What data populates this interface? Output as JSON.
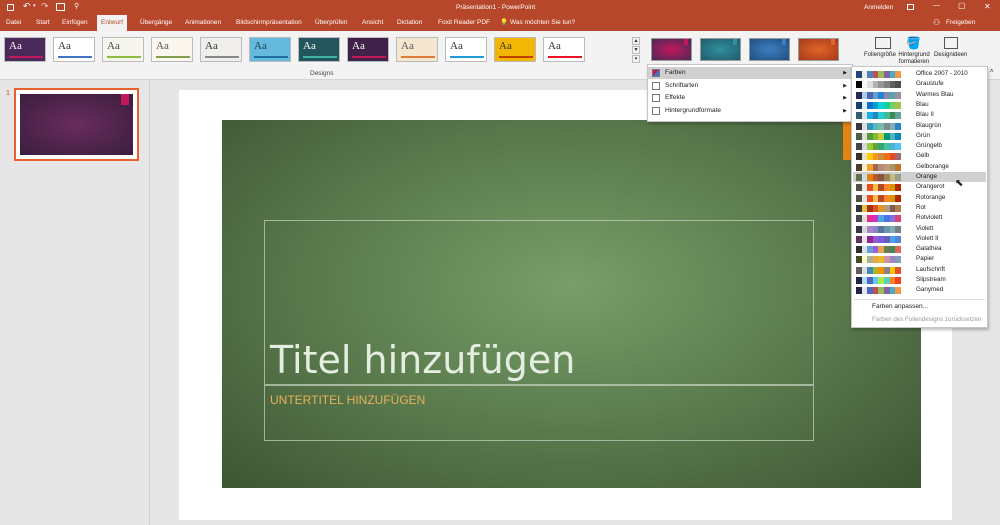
{
  "window": {
    "title": "Präsentation1 - PowerPoint",
    "user": "Anmelden",
    "share": "Freigeben",
    "quick_access": [
      "save-icon",
      "undo-icon",
      "redo-icon",
      "present-icon",
      "customize-icon"
    ],
    "window_controls": [
      "—",
      "▢",
      "✕"
    ]
  },
  "tabs": [
    "Datei",
    "Start",
    "Einfügen",
    "Entwurf",
    "Übergänge",
    "Animationen",
    "Bildschirmpräsentation",
    "Überprüfen",
    "Ansicht",
    "Dictation",
    "Foxit Reader PDF"
  ],
  "active_tab": "Entwurf",
  "tell_me": "Was möchten Sie tun?",
  "designs": {
    "group_label": "Designs",
    "theme_label": "Aa",
    "themes": [
      {
        "bg": "#4a2a5a",
        "accent": "#c2185b",
        "text": "#ffffff"
      },
      {
        "bg": "#ffffff",
        "accent": "#4472c4",
        "text": "#333333"
      },
      {
        "bg": "#f6f6ee",
        "accent": "#8cbf3f",
        "text": "#444444"
      },
      {
        "bg": "#fbf7ee",
        "accent": "#7f9f4f",
        "text": "#555555"
      },
      {
        "bg": "#f0eeea",
        "accent": "#888888",
        "text": "#333333"
      },
      {
        "bg": "#64b9dc",
        "accent": "#1e6f9f",
        "text": "#1f3b57"
      },
      {
        "bg": "#23565c",
        "accent": "#3cb4a0",
        "text": "#ffffff"
      },
      {
        "bg": "#3f2149",
        "accent": "#c2185b",
        "text": "#ffffff"
      },
      {
        "bg": "#f5e7cf",
        "accent": "#e07b39",
        "text": "#555555"
      },
      {
        "bg": "#ffffff",
        "accent": "#1f9ad6",
        "text": "#333333"
      },
      {
        "bg": "#f2b705",
        "accent": "#c04000",
        "text": "#333333"
      },
      {
        "bg": "#ffffff",
        "accent": "#e81123",
        "text": "#333333"
      }
    ],
    "variants": [
      {
        "bg": "#4a2a5a",
        "accent": "#c2185b"
      },
      {
        "bg": "#1f5c6b",
        "accent": "#2f8f9f"
      },
      {
        "bg": "#1f4f80",
        "accent": "#3d7fc0"
      },
      {
        "bg": "#a63a1a",
        "accent": "#e0652a"
      }
    ]
  },
  "customize": {
    "slide_size": "Foliengröße",
    "format_background": "Hintergrund formatieren",
    "designer": "Designideen"
  },
  "variants_menu": [
    {
      "label": "Farben",
      "underline": "F"
    },
    {
      "label": "Schriftarten",
      "underline": "S"
    },
    {
      "label": "Effekte",
      "underline": "E"
    },
    {
      "label": "Hintergrundformate",
      "underline": "H"
    }
  ],
  "color_schemes": [
    {
      "name": "Office 2007 - 2010",
      "colors": [
        "#1f497d",
        "#eeece1",
        "#4f81bd",
        "#c0504d",
        "#9bbb59",
        "#8064a2",
        "#4bacc6",
        "#f79646"
      ]
    },
    {
      "name": "Graustufe",
      "colors": [
        "#000000",
        "#f8f8f8",
        "#dddddd",
        "#b2b2b2",
        "#969696",
        "#808080",
        "#5f5f5f",
        "#4d4d4d"
      ]
    },
    {
      "name": "Warmes Blau",
      "colors": [
        "#242852",
        "#acccea",
        "#4a66ac",
        "#629dd1",
        "#297fd5",
        "#7f8fa9",
        "#5aa2ae",
        "#9d90a0"
      ]
    },
    {
      "name": "Blau",
      "colors": [
        "#17406d",
        "#dbeff9",
        "#0f6fc6",
        "#009dd9",
        "#0bd0d9",
        "#10cf9b",
        "#7cca62",
        "#a5c249"
      ]
    },
    {
      "name": "Blau II",
      "colors": [
        "#335b74",
        "#dfe3e5",
        "#1cade4",
        "#2683c6",
        "#27ced7",
        "#42ba97",
        "#3e8853",
        "#62a39f"
      ]
    },
    {
      "name": "Blaugrün",
      "colors": [
        "#373545",
        "#dedede",
        "#3494ba",
        "#58b6c0",
        "#75bda7",
        "#7a8c8e",
        "#84acb6",
        "#2683c6"
      ]
    },
    {
      "name": "Grün",
      "colors": [
        "#455f51",
        "#e3ded1",
        "#549e39",
        "#8ab833",
        "#c0cf3a",
        "#029676",
        "#4ab5c4",
        "#0989b1"
      ]
    },
    {
      "name": "Grüngelb",
      "colors": [
        "#454551",
        "#d8d9dc",
        "#99cb38",
        "#63a537",
        "#37a76f",
        "#44c1a3",
        "#4eb3cf",
        "#51c3f9"
      ]
    },
    {
      "name": "Gelb",
      "colors": [
        "#39302a",
        "#e5dec9",
        "#ffca08",
        "#f8931d",
        "#ce8d3e",
        "#ec7016",
        "#e64823",
        "#9c6a6a"
      ]
    },
    {
      "name": "Gelborange",
      "colors": [
        "#4e3b30",
        "#fbeec9",
        "#f0a22e",
        "#a5644e",
        "#b58b80",
        "#c3986d",
        "#a19574",
        "#c17529"
      ]
    },
    {
      "name": "Orange",
      "colors": [
        "#637052",
        "#ccddea",
        "#e48312",
        "#bd582c",
        "#865640",
        "#9b8357",
        "#c2bc80",
        "#94a088"
      ]
    },
    {
      "name": "Orangerot",
      "colors": [
        "#505046",
        "#eeece1",
        "#e84c22",
        "#ffbd47",
        "#b64926",
        "#ff8427",
        "#cc9900",
        "#b22600"
      ]
    },
    {
      "name": "Rotorange",
      "colors": [
        "#505046",
        "#e9e5dc",
        "#e84c22",
        "#ffbd47",
        "#b64926",
        "#ff8427",
        "#cc9900",
        "#b22600"
      ]
    },
    {
      "name": "Rot",
      "colors": [
        "#323232",
        "#e5c243",
        "#a5300f",
        "#d55816",
        "#e19825",
        "#b19c7d",
        "#7f5f52",
        "#b27d49"
      ]
    },
    {
      "name": "Rotviolett",
      "colors": [
        "#454551",
        "#e3ded1",
        "#e32d91",
        "#c830cc",
        "#4ea6dc",
        "#4775e7",
        "#8971e1",
        "#d54773"
      ]
    },
    {
      "name": "Violett",
      "colors": [
        "#373545",
        "#dcd8dc",
        "#ad84c6",
        "#8784c7",
        "#5d739a",
        "#6997af",
        "#84acb6",
        "#6f8183"
      ]
    },
    {
      "name": "Violett II",
      "colors": [
        "#632e62",
        "#eae5eb",
        "#92278f",
        "#9b57d3",
        "#755dd9",
        "#665eb8",
        "#45a5ed",
        "#5982db"
      ]
    },
    {
      "name": "Galathea",
      "colors": [
        "#2f2f2f",
        "#dbe2ec",
        "#65a0d7",
        "#9b5edb",
        "#e8a44b",
        "#6a7a59",
        "#3e8853",
        "#e1635c"
      ]
    },
    {
      "name": "Papier",
      "colors": [
        "#444d26",
        "#fefac9",
        "#a5b592",
        "#f3a447",
        "#e7bc29",
        "#d092a7",
        "#9c85c0",
        "#809ec2"
      ]
    },
    {
      "name": "Laufschrift",
      "colors": [
        "#5e5e5e",
        "#dddddd",
        "#418ab3",
        "#a6b727",
        "#f69200",
        "#838383",
        "#fec306",
        "#df5327"
      ]
    },
    {
      "name": "Slipstream",
      "colors": [
        "#212745",
        "#b4dcfa",
        "#4e67c8",
        "#5eccf3",
        "#a7ea52",
        "#5dceaf",
        "#ff8021",
        "#f14124"
      ]
    },
    {
      "name": "Ganymed",
      "colors": [
        "#212745",
        "#e4e9ef",
        "#4e67c8",
        "#c0504d",
        "#9bbb59",
        "#8064a2",
        "#4bacc6",
        "#f79646"
      ]
    }
  ],
  "highlighted_scheme": "Orange",
  "color_footer": [
    "Farben anpassen...",
    "Farben des Foliendesigns zurücksetzen"
  ],
  "slide_panel": {
    "number": "1"
  },
  "slide": {
    "title": "Titel hinzufügen",
    "subtitle": "UNTERTITEL HINZUFÜGEN"
  }
}
